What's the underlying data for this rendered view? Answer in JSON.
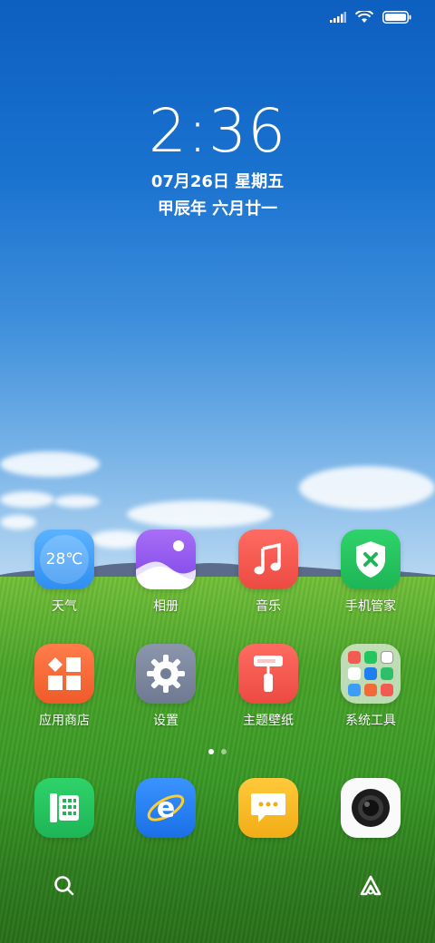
{
  "status_bar": {
    "signal_icon": "signal-icon",
    "wifi_icon": "wifi-icon",
    "battery_icon": "battery-icon"
  },
  "lockclock": {
    "time": "2:36",
    "date": "07月26日 星期五",
    "lunar": "甲辰年 六月廿一"
  },
  "apps_row1": [
    {
      "label": "天气",
      "text": "28℃"
    },
    {
      "label": "相册"
    },
    {
      "label": "音乐"
    },
    {
      "label": "手机管家"
    }
  ],
  "apps_row2": [
    {
      "label": "应用商店"
    },
    {
      "label": "设置"
    },
    {
      "label": "主题壁纸"
    },
    {
      "label": "系统工具"
    }
  ],
  "dock": [
    "phone",
    "browser",
    "messages",
    "camera"
  ],
  "colors": {
    "weather": "#3d9cf5",
    "gallery": "#9b59f0",
    "music": "#f25a52",
    "security": "#22c55e",
    "store": "#f26a3a",
    "settings": "#7f8aa0",
    "themes": "#f25a52",
    "phone": "#22c55e",
    "browser": "#1e7ff0",
    "messages": "#f5b921"
  }
}
